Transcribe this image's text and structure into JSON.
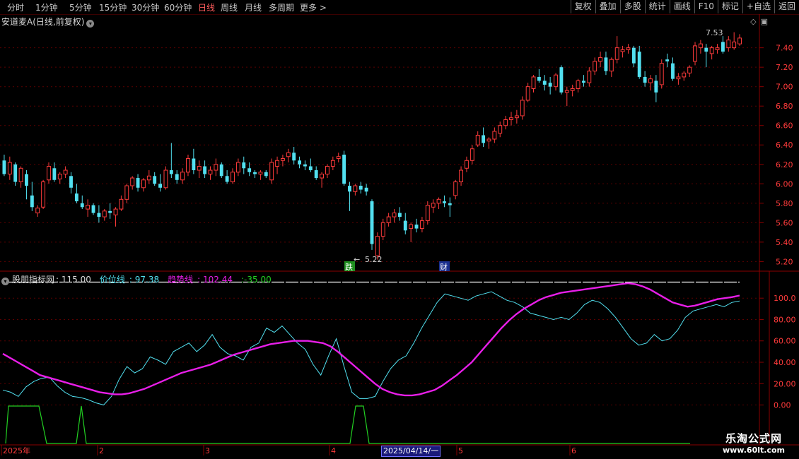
{
  "toolbar": {
    "timeframes": [
      "分时",
      "1分钟",
      "5分钟",
      "15分钟",
      "30分钟",
      "60分钟",
      "日线",
      "周线",
      "月线",
      "多周期",
      "更多 >"
    ],
    "active_timeframe": "日线",
    "tools": [
      "复权",
      "叠加",
      "多股",
      "统计",
      "画线",
      "F10",
      "标记",
      "+自选",
      "返回"
    ]
  },
  "stock": {
    "title": "安道麦A(日线,前复权)",
    "collapse_icon": "chevron-down-icon"
  },
  "colors": {
    "up": "#ff3b3b",
    "down": "#52e0f0",
    "accent": "#ff5c5c",
    "price_line": "#52e0f0",
    "trend_line": "#e81ee8",
    "signal": "#22d022"
  },
  "chart_data": [
    {
      "type": "candlestick",
      "yaxis_ticks": [
        "7.40",
        "7.20",
        "7.00",
        "6.80",
        "6.60",
        "6.40",
        "6.20",
        "6.00",
        "5.80",
        "5.60",
        "5.40",
        "5.20"
      ],
      "ylim": [
        5.13,
        7.63
      ],
      "annotations": {
        "low_label": "5.22",
        "high_label": "7.53",
        "event_markers": [
          "跌",
          "财"
        ]
      },
      "ohlc": [
        [
          6.24,
          6.3,
          6.08,
          6.1
        ],
        [
          6.1,
          6.28,
          6.04,
          6.22
        ],
        [
          6.2,
          6.22,
          5.98,
          6.02
        ],
        [
          6.02,
          6.18,
          5.96,
          6.16
        ],
        [
          6.1,
          6.14,
          5.84,
          5.98
        ],
        [
          5.88,
          6.02,
          5.72,
          5.76
        ],
        [
          5.7,
          5.78,
          5.66,
          5.75
        ],
        [
          5.76,
          6.04,
          5.74,
          6.02
        ],
        [
          6.04,
          6.22,
          6.0,
          6.18
        ],
        [
          6.16,
          6.22,
          6.02,
          6.04
        ],
        [
          6.05,
          6.12,
          6.0,
          6.1
        ],
        [
          6.1,
          6.18,
          6.06,
          6.14
        ],
        [
          6.08,
          6.12,
          5.9,
          5.96
        ],
        [
          5.9,
          6.0,
          5.8,
          5.82
        ],
        [
          5.8,
          5.88,
          5.74,
          5.76
        ],
        [
          5.74,
          5.84,
          5.66,
          5.78
        ],
        [
          5.78,
          5.8,
          5.68,
          5.7
        ],
        [
          5.7,
          5.78,
          5.6,
          5.66
        ],
        [
          5.66,
          5.74,
          5.62,
          5.72
        ],
        [
          5.72,
          5.8,
          5.64,
          5.7
        ],
        [
          5.68,
          5.76,
          5.56,
          5.74
        ],
        [
          5.74,
          5.88,
          5.72,
          5.84
        ],
        [
          5.84,
          6.0,
          5.8,
          5.98
        ],
        [
          5.98,
          6.08,
          5.94,
          6.06
        ],
        [
          6.06,
          6.1,
          5.92,
          5.96
        ],
        [
          5.96,
          6.06,
          5.92,
          6.04
        ],
        [
          6.04,
          6.14,
          6.0,
          6.08
        ],
        [
          6.08,
          6.12,
          5.98,
          6.0
        ],
        [
          6.0,
          6.1,
          5.92,
          5.96
        ],
        [
          5.96,
          6.18,
          5.94,
          6.14
        ],
        [
          6.14,
          6.42,
          6.06,
          6.1
        ],
        [
          6.1,
          6.14,
          6.0,
          6.04
        ],
        [
          6.04,
          6.16,
          6.0,
          6.12
        ],
        [
          6.12,
          6.3,
          6.08,
          6.26
        ],
        [
          6.26,
          6.36,
          6.1,
          6.14
        ],
        [
          6.14,
          6.24,
          6.06,
          6.18
        ],
        [
          6.18,
          6.24,
          6.06,
          6.1
        ],
        [
          6.1,
          6.18,
          6.04,
          6.14
        ],
        [
          6.14,
          6.26,
          6.08,
          6.2
        ],
        [
          6.2,
          6.22,
          6.06,
          6.08
        ],
        [
          6.08,
          6.14,
          6.0,
          6.02
        ],
        [
          6.02,
          6.16,
          6.0,
          6.12
        ],
        [
          6.12,
          6.26,
          6.08,
          6.22
        ],
        [
          6.22,
          6.28,
          6.1,
          6.16
        ],
        [
          6.16,
          6.22,
          6.08,
          6.12
        ],
        [
          6.12,
          6.14,
          6.06,
          6.1
        ],
        [
          6.1,
          6.14,
          6.04,
          6.12
        ],
        [
          6.12,
          6.14,
          6.06,
          6.08
        ],
        [
          6.04,
          6.26,
          6.0,
          6.22
        ],
        [
          6.18,
          6.28,
          6.1,
          6.24
        ],
        [
          6.24,
          6.3,
          6.18,
          6.26
        ],
        [
          6.28,
          6.36,
          6.22,
          6.32
        ],
        [
          6.32,
          6.38,
          6.2,
          6.24
        ],
        [
          6.24,
          6.28,
          6.16,
          6.2
        ],
        [
          6.2,
          6.24,
          6.14,
          6.18
        ],
        [
          6.18,
          6.26,
          6.12,
          6.14
        ],
        [
          6.14,
          6.18,
          6.04,
          6.06
        ],
        [
          6.06,
          6.12,
          5.96,
          6.1
        ],
        [
          6.1,
          6.2,
          6.06,
          6.18
        ],
        [
          6.18,
          6.28,
          6.14,
          6.24
        ],
        [
          6.26,
          6.32,
          6.22,
          6.28
        ],
        [
          6.3,
          6.34,
          5.98,
          6.0
        ],
        [
          5.98,
          6.02,
          5.72,
          5.92
        ],
        [
          5.92,
          6.0,
          5.88,
          5.98
        ],
        [
          5.98,
          6.02,
          5.9,
          5.94
        ],
        [
          5.96,
          6.0,
          5.88,
          5.92
        ],
        [
          5.82,
          5.84,
          5.32,
          5.38
        ],
        [
          5.26,
          5.5,
          5.22,
          5.46
        ],
        [
          5.46,
          5.64,
          5.42,
          5.6
        ],
        [
          5.6,
          5.7,
          5.56,
          5.66
        ],
        [
          5.66,
          5.74,
          5.6,
          5.7
        ],
        [
          5.7,
          5.76,
          5.62,
          5.66
        ],
        [
          5.62,
          5.7,
          5.48,
          5.52
        ],
        [
          5.54,
          5.6,
          5.4,
          5.58
        ],
        [
          5.58,
          5.64,
          5.5,
          5.54
        ],
        [
          5.54,
          5.66,
          5.5,
          5.62
        ],
        [
          5.62,
          5.82,
          5.58,
          5.78
        ],
        [
          5.76,
          5.84,
          5.7,
          5.8
        ],
        [
          5.8,
          5.86,
          5.74,
          5.84
        ],
        [
          5.82,
          5.88,
          5.76,
          5.8
        ],
        [
          5.8,
          5.86,
          5.66,
          5.78
        ],
        [
          5.88,
          6.04,
          5.84,
          6.02
        ],
        [
          6.02,
          6.18,
          5.98,
          6.14
        ],
        [
          6.16,
          6.28,
          6.12,
          6.24
        ],
        [
          6.24,
          6.4,
          6.2,
          6.36
        ],
        [
          6.4,
          6.54,
          6.38,
          6.5
        ],
        [
          6.5,
          6.58,
          6.38,
          6.42
        ],
        [
          6.44,
          6.48,
          6.36,
          6.46
        ],
        [
          6.46,
          6.58,
          6.42,
          6.54
        ],
        [
          6.52,
          6.64,
          6.48,
          6.6
        ],
        [
          6.6,
          6.7,
          6.56,
          6.66
        ],
        [
          6.66,
          6.74,
          6.6,
          6.68
        ],
        [
          6.68,
          6.76,
          6.62,
          6.7
        ],
        [
          6.7,
          6.9,
          6.66,
          6.86
        ],
        [
          6.86,
          7.04,
          6.84,
          7.0
        ],
        [
          6.98,
          7.12,
          6.94,
          7.1
        ],
        [
          7.1,
          7.18,
          7.04,
          7.06
        ],
        [
          7.06,
          7.12,
          6.96,
          7.02
        ],
        [
          7.04,
          7.1,
          6.92,
          7.0
        ],
        [
          7.0,
          7.14,
          6.96,
          7.12
        ],
        [
          7.2,
          7.22,
          6.92,
          6.94
        ],
        [
          6.94,
          7.0,
          6.8,
          6.96
        ],
        [
          6.96,
          7.02,
          6.9,
          6.98
        ],
        [
          6.98,
          7.08,
          6.94,
          7.06
        ],
        [
          7.06,
          7.12,
          7.0,
          7.04
        ],
        [
          7.04,
          7.2,
          7.0,
          7.16
        ],
        [
          7.16,
          7.3,
          7.12,
          7.26
        ],
        [
          7.26,
          7.36,
          7.2,
          7.3
        ],
        [
          7.3,
          7.36,
          7.12,
          7.16
        ],
        [
          7.16,
          7.3,
          7.1,
          7.28
        ],
        [
          7.28,
          7.52,
          7.24,
          7.4
        ],
        [
          7.36,
          7.42,
          7.3,
          7.38
        ],
        [
          7.38,
          7.44,
          7.34,
          7.4
        ],
        [
          7.4,
          7.42,
          7.2,
          7.24
        ],
        [
          7.36,
          7.42,
          7.08,
          7.1
        ],
        [
          7.1,
          7.16,
          7.0,
          7.04
        ],
        [
          7.04,
          7.12,
          6.96,
          7.08
        ],
        [
          7.06,
          7.12,
          6.84,
          6.94
        ],
        [
          7.02,
          7.28,
          6.98,
          7.24
        ],
        [
          7.28,
          7.34,
          7.2,
          7.26
        ],
        [
          7.24,
          7.3,
          7.06,
          7.08
        ],
        [
          7.08,
          7.14,
          7.02,
          7.1
        ],
        [
          7.1,
          7.16,
          7.06,
          7.14
        ],
        [
          7.14,
          7.22,
          7.1,
          7.2
        ],
        [
          7.26,
          7.46,
          7.22,
          7.42
        ],
        [
          7.4,
          7.48,
          7.34,
          7.44
        ],
        [
          7.4,
          7.44,
          7.2,
          7.36
        ],
        [
          7.34,
          7.42,
          7.28,
          7.4
        ],
        [
          7.38,
          7.44,
          7.34,
          7.4
        ],
        [
          7.46,
          7.52,
          7.34,
          7.36
        ],
        [
          7.4,
          7.52,
          7.36,
          7.48
        ],
        [
          7.4,
          7.56,
          7.38,
          7.46
        ],
        [
          7.44,
          7.54,
          7.42,
          7.5
        ]
      ]
    },
    {
      "type": "line",
      "title": "股朋指标网",
      "header_value": "115.00",
      "yaxis_ticks": [
        "100.0",
        "80.00",
        "60.00",
        "40.00",
        "20.00",
        "0.00"
      ],
      "ylim": [
        -36,
        116
      ],
      "series": [
        {
          "name": "价位线",
          "value_label": "97.38",
          "values": [
            14,
            12,
            8,
            17,
            22,
            25,
            26,
            18,
            12,
            8,
            7,
            5,
            2,
            0,
            8,
            24,
            36,
            30,
            34,
            45,
            42,
            38,
            50,
            54,
            58,
            50,
            56,
            66,
            54,
            48,
            46,
            42,
            54,
            58,
            72,
            68,
            74,
            66,
            58,
            52,
            38,
            28,
            46,
            62,
            36,
            12,
            6,
            6,
            8,
            22,
            34,
            42,
            46,
            58,
            72,
            84,
            96,
            104,
            102,
            100,
            98,
            102,
            104,
            106,
            102,
            98,
            96,
            92,
            86,
            84,
            82,
            80,
            82,
            80,
            86,
            94,
            98,
            96,
            90,
            82,
            72,
            62,
            56,
            58,
            66,
            60,
            62,
            70,
            82,
            88,
            90,
            92,
            94,
            92,
            96,
            97.38
          ]
        },
        {
          "name": "趋势线",
          "value_label": "102.44",
          "values": [
            48,
            44,
            40,
            36,
            32,
            28,
            26,
            24,
            22,
            20,
            18,
            16,
            14,
            12,
            11,
            10,
            10,
            11,
            13,
            15,
            18,
            21,
            24,
            27,
            30,
            32,
            34,
            36,
            38,
            41,
            44,
            47,
            49,
            51,
            53,
            55,
            57,
            58,
            59,
            60,
            60,
            60,
            59,
            58,
            55,
            50,
            44,
            38,
            32,
            26,
            20,
            15,
            12,
            10,
            9,
            9,
            10,
            12,
            14,
            18,
            23,
            28,
            34,
            40,
            48,
            56,
            64,
            72,
            79,
            85,
            90,
            94,
            98,
            101,
            103,
            105,
            106,
            107,
            108,
            109,
            110,
            111,
            112,
            113,
            114,
            113,
            111,
            108,
            104,
            100,
            96,
            94,
            92,
            93,
            95,
            97,
            99,
            100,
            101,
            102.44
          ]
        },
        {
          "name": "",
          "value_label": "-35.00",
          "values": [
            -35
          ]
        }
      ]
    }
  ],
  "xaxis_labels": [
    "2025年",
    "2",
    "3",
    "4",
    "5",
    "6"
  ],
  "crosshair_date": "2025/04/14/一",
  "watermark": {
    "line1": "乐淘公式网",
    "line2": "www.60lt.com"
  }
}
